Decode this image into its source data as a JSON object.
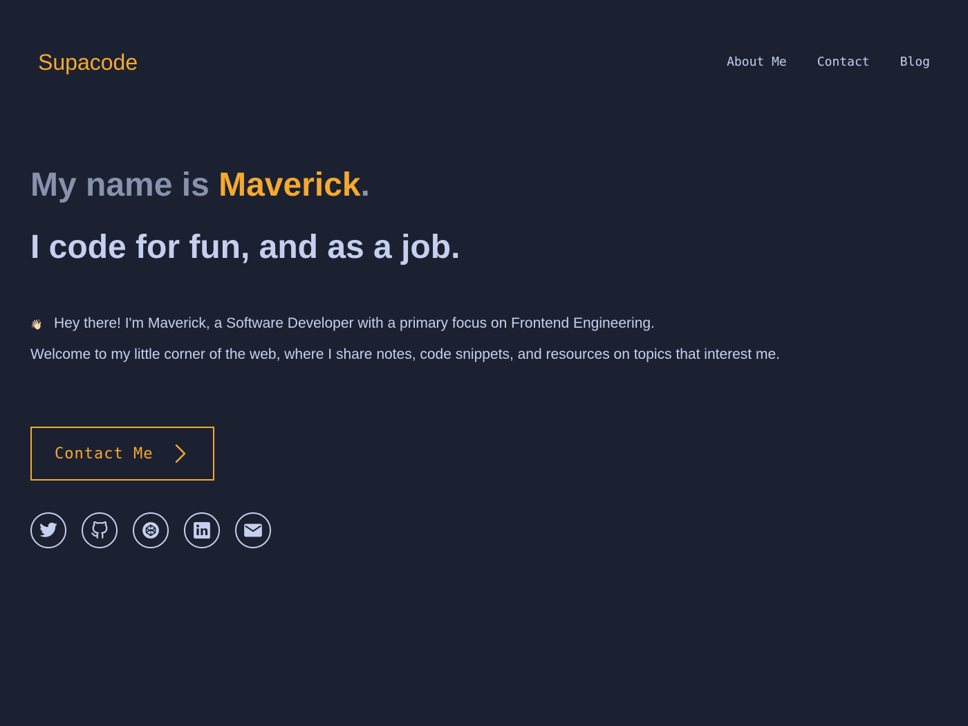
{
  "header": {
    "logo": "Supacode",
    "nav": [
      "About Me",
      "Contact",
      "Blog"
    ]
  },
  "hero": {
    "name_prefix": "My name is ",
    "name": "Maverick",
    "name_suffix": ".",
    "tagline": "I code for fun, and as a job.",
    "intro_line1": "Hey there! I'm Maverick, a Software Developer with a primary focus on Frontend Engineering.",
    "intro_line2": "Welcome to my little corner of the web, where I share notes, code snippets, and resources on topics that interest me.",
    "wave_glyph": "👋🏻"
  },
  "cta": {
    "label": "Contact Me",
    "icon": "chevron-right-icon"
  },
  "socials": [
    {
      "icon": "twitter-icon"
    },
    {
      "icon": "github-icon"
    },
    {
      "icon": "codepen-icon"
    },
    {
      "icon": "linkedin-icon"
    },
    {
      "icon": "mail-icon"
    }
  ],
  "colors": {
    "background": "#1b2131",
    "accent": "#f5a92f",
    "text": "#c7cfef",
    "muted": "#8891ad"
  }
}
